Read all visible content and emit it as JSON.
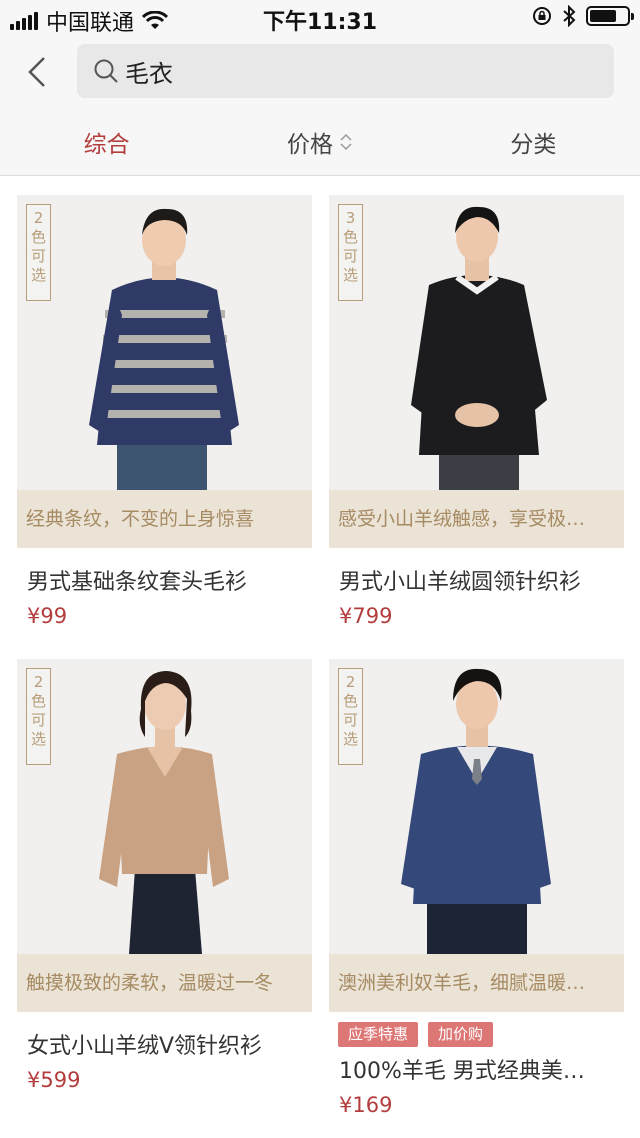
{
  "status": {
    "carrier": "中国联通",
    "time": "下午11:31",
    "battery_level": 0.72
  },
  "search": {
    "query": "毛衣"
  },
  "tabs": [
    {
      "label": "综合",
      "active": true
    },
    {
      "label": "价格",
      "active": false
    },
    {
      "label": "分类",
      "active": false
    }
  ],
  "products": [
    {
      "badge": "2色可选",
      "slogan": "经典条纹，不变的上身惊喜",
      "name": "男式基础条纹套头毛衫",
      "price": "¥99",
      "tags": []
    },
    {
      "badge": "3色可选",
      "slogan": "感受小山羊绒触感，享受极…",
      "name": "男式小山羊绒圆领针织衫",
      "price": "¥799",
      "tags": []
    },
    {
      "badge": "2色可选",
      "slogan": "触摸极致的柔软，温暖过一冬",
      "name": "女式小山羊绒V领针织衫",
      "price": "¥599",
      "tags": []
    },
    {
      "badge": "2色可选",
      "slogan": "澳洲美利奴羊毛，细腻温暖…",
      "name": "100%羊毛 男式经典美…",
      "price": "¥169",
      "tags": [
        "应季特惠",
        "加价购"
      ]
    }
  ],
  "colors": {
    "accent": "#b33d3d",
    "slogan_bg": "#ebe3d6",
    "slogan_text": "#a68b63",
    "tag_bg": "#dd7776"
  }
}
